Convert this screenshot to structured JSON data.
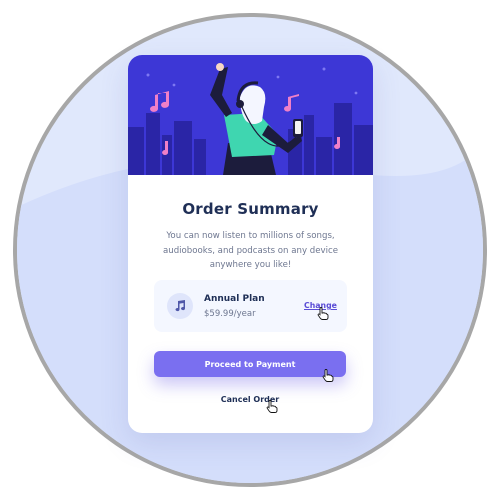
{
  "card": {
    "title": "Order Summary",
    "description": "You can now listen to millions of songs, audiobooks, and podcasts on any device anywhere you like!"
  },
  "plan": {
    "name": "Annual Plan",
    "price": "$59.99/year",
    "change_label": "Change",
    "icon": "music-note-icon"
  },
  "actions": {
    "proceed_label": "Proceed to Payment",
    "cancel_label": "Cancel Order"
  },
  "colors": {
    "hero": "#3d37d6",
    "accent": "#7a6ff0",
    "title": "#1f2f56",
    "background": "#e0e8fc"
  }
}
